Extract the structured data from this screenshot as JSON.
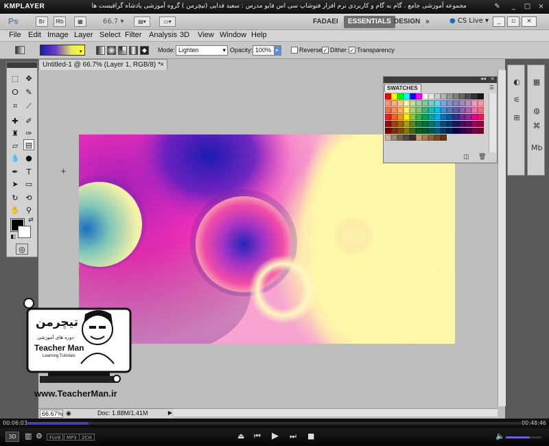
{
  "kmplayer": {
    "logo": "KMPLAYER",
    "caption": "مجموعه آموزشی جامع . گام به گام و کاربردی نرم افزار فتوشاپ سی اس فایو  مدرس : سعید فدایی (تیچرمن ) گروه آموزشی پادشاه گرافیست ها",
    "time_elapsed": "00:06:03",
    "time_total": "00:48:46",
    "progress": 0.124,
    "volume": 0.68,
    "badges": [
      "FLV6",
      "MP3",
      "2CH"
    ],
    "badge_3d": "3D"
  },
  "photoshop": {
    "logo": "Ps",
    "mini_buttons": [
      "Br",
      "Mb"
    ],
    "zoom_select": "66.7",
    "workspaces": [
      "FADAEI",
      "ESSENTIALS",
      "DESIGN"
    ],
    "workspace_more": "»",
    "active_workspace": "ESSENTIALS",
    "cs_live": "CS Live",
    "menu": [
      "File",
      "Edit",
      "Image",
      "Layer",
      "Select",
      "Filter",
      "Analysis",
      "3D",
      "View",
      "Window",
      "Help"
    ],
    "options": {
      "mode_label": "Mode:",
      "mode_value": "Lighten",
      "opacity_label": "Opacity:",
      "opacity_value": "100%",
      "reverse_label": "Reverse",
      "reverse_checked": false,
      "dither_label": "Dither",
      "dither_checked": true,
      "transparency_label": "Transparency",
      "transparency_checked": true
    },
    "document": {
      "tab_title": "Untitled-1 @ 66.7% (Layer 1, RGB/8) *",
      "close": "×",
      "status_zoom": "66.67%",
      "status_doc": "Doc: 1.88M/1.41M"
    },
    "swatches_title": "SWATCHES",
    "swatch_rows": [
      [
        "#ff0000",
        "#ffff00",
        "#00ff00",
        "#00ffff",
        "#0000ff",
        "#ff00ff",
        "#ffffff",
        "#e6e6e6",
        "#cccccc",
        "#b3b3b3",
        "#999999",
        "#808080",
        "#666666",
        "#4d4d4d",
        "#333333",
        "#1a1a1a"
      ],
      [
        "#f7977a",
        "#f9ad81",
        "#fdc68a",
        "#fff79a",
        "#c4df9b",
        "#a2d39c",
        "#82ca9d",
        "#7bcdc8",
        "#6ecff6",
        "#7ea7d8",
        "#8493ca",
        "#8882be",
        "#a187be",
        "#bc8dbf",
        "#f49ac2",
        "#f6989d"
      ],
      [
        "#f26c4f",
        "#f68e55",
        "#fbaf5c",
        "#fff467",
        "#acd372",
        "#7cc576",
        "#3bb878",
        "#1abbb4",
        "#00bff3",
        "#438ccb",
        "#5574b9",
        "#605ca8",
        "#855fa8",
        "#a763a8",
        "#f06eaa",
        "#f26d7d"
      ],
      [
        "#ed1c24",
        "#f26522",
        "#f7941d",
        "#fff200",
        "#8dc73f",
        "#39b54a",
        "#00a651",
        "#00a99d",
        "#00aeef",
        "#0072bc",
        "#0054a6",
        "#2e3192",
        "#662d91",
        "#92278f",
        "#ec008c",
        "#ed145b"
      ],
      [
        "#9e0b0f",
        "#a0410d",
        "#a3620a",
        "#aba000",
        "#598527",
        "#1a7b30",
        "#007236",
        "#00746b",
        "#0076a3",
        "#004b80",
        "#003471",
        "#1b1464",
        "#440e62",
        "#630460",
        "#9e005d",
        "#9e0039"
      ],
      [
        "#790000",
        "#7b2e00",
        "#7d4900",
        "#827b00",
        "#406618",
        "#005e20",
        "#005826",
        "#005952",
        "#005b7f",
        "#003663",
        "#002157",
        "#0d004c",
        "#32004b",
        "#4b0049",
        "#7b0046",
        "#7a0026"
      ],
      [
        "#c7b299",
        "#998675",
        "#736357",
        "#534741",
        "#37302d",
        "#c69c6d",
        "#a67c52",
        "#8c6239",
        "#754c24",
        "#603913"
      ]
    ],
    "dock_panels": [
      "color-panel",
      "adjustments-panel",
      "masks-panel",
      "layers-panel",
      "channels-panel",
      "paths-panel",
      "mini-bridge-panel"
    ]
  },
  "watermark": {
    "brand_fa": "تیچرمن",
    "tagline_fa": "دوره های آموزشی",
    "brand_en": "Teacher Man",
    "sub_en": "Learning Tutorials",
    "website": "www.TeacherMan.ir"
  }
}
